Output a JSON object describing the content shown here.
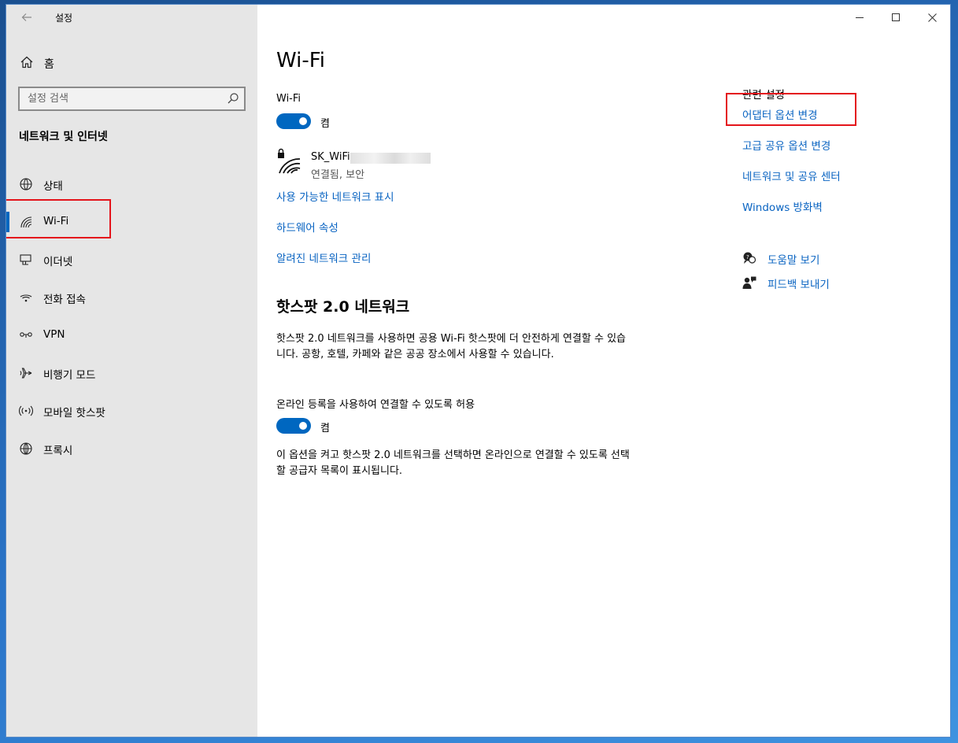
{
  "window": {
    "app_title": "설정"
  },
  "sidebar": {
    "home_label": "홈",
    "search_placeholder": "설정 검색",
    "section_title": "네트워크 및 인터넷",
    "items": [
      {
        "label": "상태",
        "icon": "globe-status-icon"
      },
      {
        "label": "Wi-Fi",
        "icon": "wifi-icon",
        "active": true
      },
      {
        "label": "이더넷",
        "icon": "ethernet-icon"
      },
      {
        "label": "전화 접속",
        "icon": "dialup-icon"
      },
      {
        "label": "VPN",
        "icon": "vpn-icon"
      },
      {
        "label": "비행기 모드",
        "icon": "airplane-icon"
      },
      {
        "label": "모바일 핫스팟",
        "icon": "hotspot-icon"
      },
      {
        "label": "프록시",
        "icon": "globe-icon"
      }
    ]
  },
  "main": {
    "title": "Wi-Fi",
    "wifi_label": "Wi-Fi",
    "wifi_toggle_state": "켬",
    "network": {
      "name": "SK_WiFi",
      "status": "연결됨, 보안"
    },
    "links": [
      "사용 가능한 네트워크 표시",
      "하드웨어 속성",
      "알려진 네트워크 관리"
    ],
    "hotspot": {
      "title": "핫스팟 2.0 네트워크",
      "description": "핫스팟 2.0 네트워크를 사용하면 공용 Wi-Fi 핫스팟에 더 안전하게 연결할 수 있습니다. 공항, 호텔, 카페와 같은 공공 장소에서 사용할 수 있습니다.",
      "online_signup_label": "온라인 등록을 사용하여 연결할 수 있도록 허용",
      "online_toggle_state": "켬",
      "note": "이 옵션을 켜고 핫스팟 2.0 네트워크를 선택하면 온라인으로 연결할 수 있도록 선택할 공급자 목록이 표시됩니다."
    }
  },
  "related": {
    "title": "관련 설정",
    "links": [
      "어댑터 옵션 변경",
      "고급 공유 옵션 변경",
      "네트워크 및 공유 센터",
      "Windows 방화벽"
    ],
    "help_label": "도움말 보기",
    "feedback_label": "피드백 보내기"
  },
  "colors": {
    "accent": "#0067c0",
    "link": "#0a64c2",
    "highlight": "#e4141b",
    "sidebar_bg": "#e6e6e6"
  }
}
